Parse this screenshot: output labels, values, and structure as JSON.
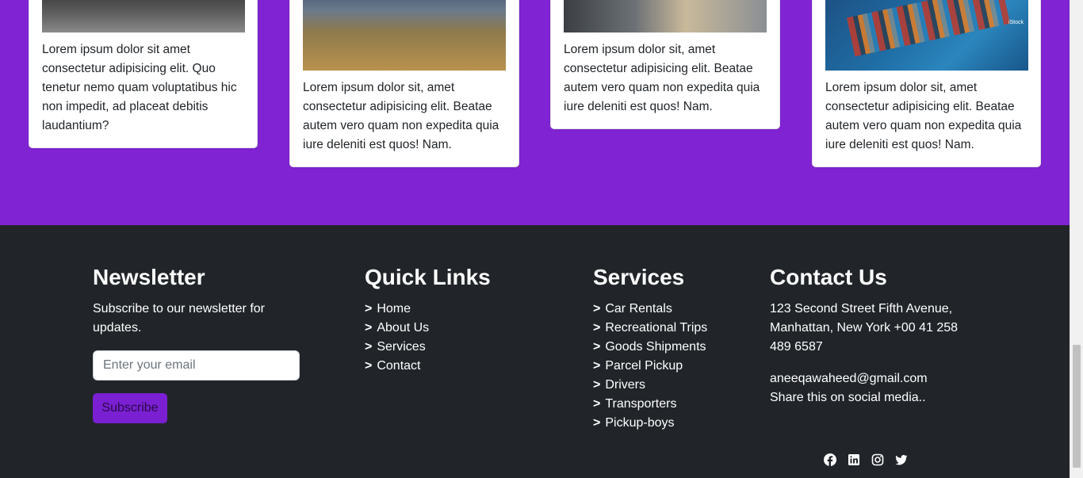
{
  "cards": [
    {
      "text": "Lorem ipsum dolor sit amet consectetur adipisicing elit. Quo tenetur nemo quam voluptatibus hic non impedit, ad placeat debitis laudantium?"
    },
    {
      "text": "Lorem ipsum dolor sit, amet consectetur adipisicing elit. Beatae autem vero quam non expedita quia iure deleniti est quos! Nam."
    },
    {
      "text": "Lorem ipsum dolor sit, amet consectetur adipisicing elit. Beatae autem vero quam non expedita quia iure deleniti est quos! Nam."
    },
    {
      "text": "Lorem ipsum dolor sit, amet consectetur adipisicing elit. Beatae autem vero quam non expedita quia iure deleniti est quos! Nam.",
      "image_credit": "iStock"
    }
  ],
  "newsletter": {
    "title": "Newsletter",
    "subtitle": "Subscribe to our newsletter for updates.",
    "email_placeholder": "Enter your email",
    "button_label": "Subscribe"
  },
  "quick_links": {
    "title": "Quick Links",
    "arrow": ">",
    "items": [
      "Home",
      "About Us",
      "Services",
      "Contact"
    ]
  },
  "services": {
    "title": "Services",
    "arrow": ">",
    "items": [
      "Car Rentals",
      "Recreational Trips",
      "Goods Shipments",
      "Parcel Pickup",
      "Drivers",
      "Transporters",
      "Pickup-boys"
    ]
  },
  "contact": {
    "title": "Contact Us",
    "address": "123 Second Street Fifth Avenue, Manhattan, New York +00 41 258 489 6587",
    "email": "aneeqawaheed@gmail.com",
    "share_text": "Share this on social media..",
    "social_icons": [
      "facebook-icon",
      "linkedin-icon",
      "instagram-icon",
      "twitter-icon"
    ]
  },
  "colors": {
    "accent": "#8024d3",
    "footer_bg": "#212529",
    "button": "#7a1fd1"
  }
}
